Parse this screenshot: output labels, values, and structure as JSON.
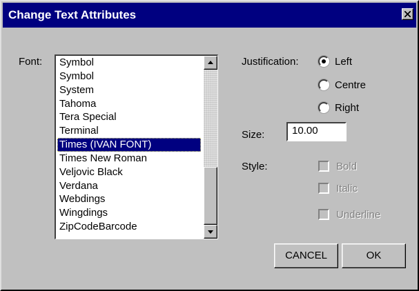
{
  "window": {
    "title": "Change Text Attributes"
  },
  "font": {
    "label": "Font:",
    "items": [
      "Symbol",
      "Symbol",
      "System",
      "Tahoma",
      "Tera Special",
      "Terminal",
      "Times (IVAN FONT)",
      "Times New Roman",
      "Veljovic Black",
      "Verdana",
      "Webdings",
      "Wingdings",
      "ZipCodeBarcode"
    ],
    "selected": "Times (IVAN FONT)"
  },
  "justification": {
    "label": "Justification:",
    "options": [
      "Left",
      "Centre",
      "Right"
    ],
    "selected": "Left"
  },
  "size": {
    "label": "Size:",
    "value": "10.00"
  },
  "style": {
    "label": "Style:",
    "options": [
      {
        "label": "Bold",
        "checked": false,
        "enabled": false
      },
      {
        "label": "Italic",
        "checked": false,
        "enabled": false
      },
      {
        "label": "Underline",
        "checked": false,
        "enabled": false
      }
    ]
  },
  "buttons": {
    "cancel": "CANCEL",
    "ok": "OK"
  },
  "colors": {
    "titlebar": "#000080",
    "face": "#c0c0c0",
    "selection": "#000080"
  },
  "icons": {
    "close": "close-icon",
    "scroll_up": "arrow-up-icon",
    "scroll_down": "arrow-down-icon"
  }
}
